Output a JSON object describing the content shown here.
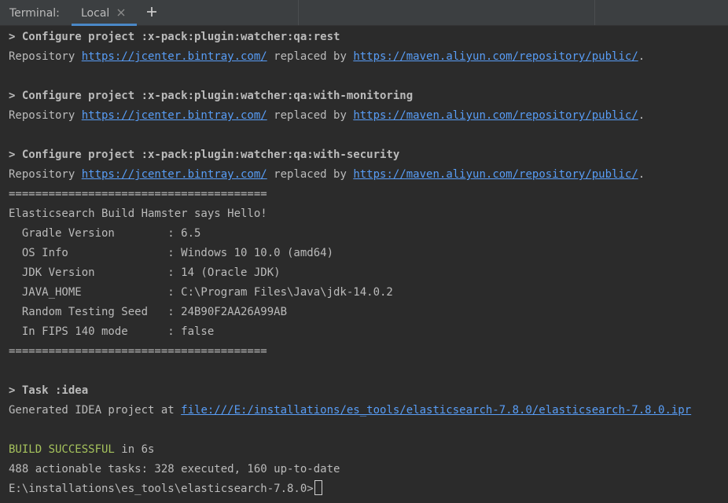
{
  "tabbar": {
    "title": "Terminal:",
    "tab_label": "Local",
    "close_icon": "close-icon",
    "new_tab_icon": "plus-icon"
  },
  "colors": {
    "background": "#2b2b2b",
    "text": "#bbbbbb",
    "link": "#589df6",
    "success": "#a5c25c",
    "tab_underline": "#4a88c7"
  },
  "terminal": {
    "config1": {
      "header": "> Configure project :x-pack:plugin:watcher:qa:rest",
      "pre": "Repository ",
      "url1": "https://jcenter.bintray.com/",
      "mid": " replaced by ",
      "url2": "https://maven.aliyun.com/repository/public/",
      "post": "."
    },
    "config2": {
      "header": "> Configure project :x-pack:plugin:watcher:qa:with-monitoring",
      "pre": "Repository ",
      "url1": "https://jcenter.bintray.com/",
      "mid": " replaced by ",
      "url2": "https://maven.aliyun.com/repository/public/",
      "post": "."
    },
    "config3": {
      "header": "> Configure project :x-pack:plugin:watcher:qa:with-security",
      "pre": "Repository ",
      "url1": "https://jcenter.bintray.com/",
      "mid": " replaced by ",
      "url2": "https://maven.aliyun.com/repository/public/",
      "post": "."
    },
    "separator": "=======================================",
    "hamster_hello": "Elasticsearch Build Hamster says Hello!",
    "info": [
      "  Gradle Version        : 6.5",
      "  OS Info               : Windows 10 10.0 (amd64)",
      "  JDK Version           : 14 (Oracle JDK)",
      "  JAVA_HOME             : C:\\Program Files\\Java\\jdk-14.0.2",
      "  Random Testing Seed   : 24B90F2AA26A99AB",
      "  In FIPS 140 mode      : false"
    ],
    "task": {
      "header": "> Task :idea",
      "pre": "Generated IDEA project at ",
      "url": "file:///E:/installations/es_tools/elasticsearch-7.8.0/elasticsearch-7.8.0.ipr"
    },
    "build": {
      "status": "BUILD SUCCESSFUL",
      "time": " in 6s",
      "tasks": "488 actionable tasks: 328 executed, 160 up-to-date"
    },
    "prompt": "E:\\installations\\es_tools\\elasticsearch-7.8.0>"
  }
}
